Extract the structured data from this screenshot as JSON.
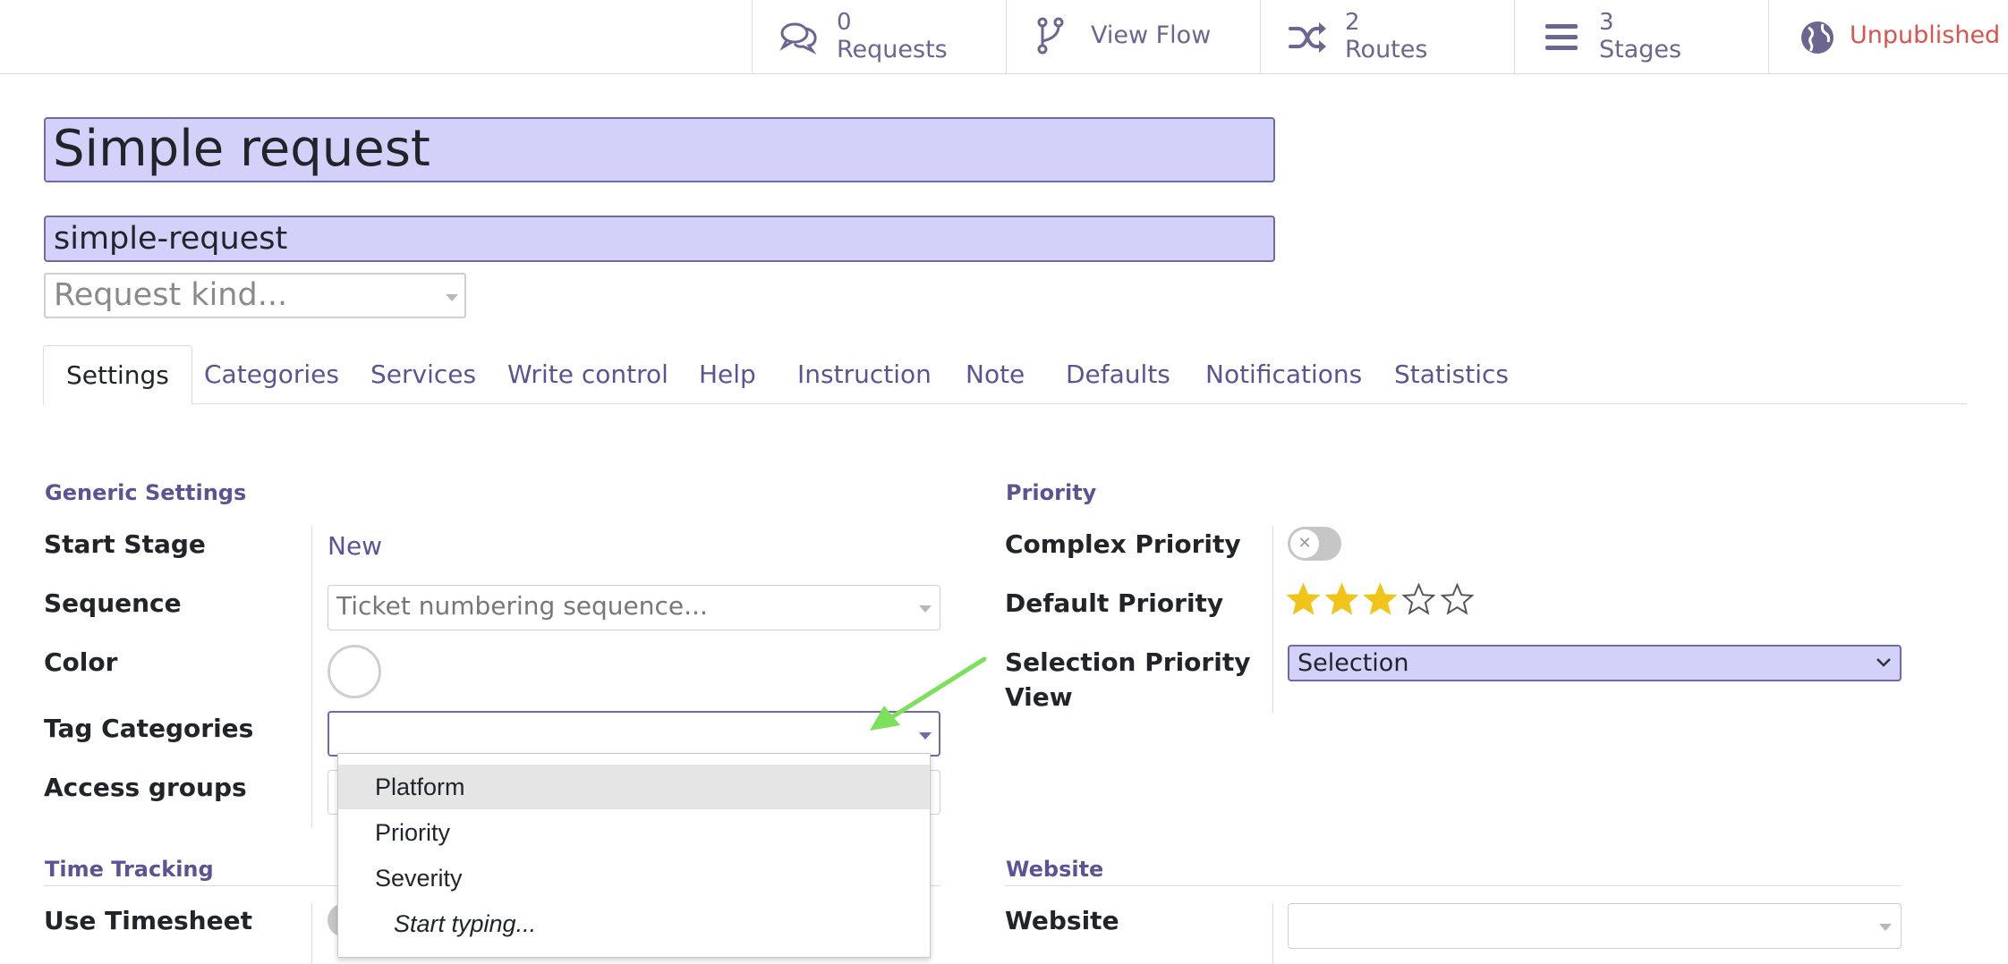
{
  "stat_buttons": {
    "requests": {
      "count": "0",
      "label": "Requests",
      "icon": "chat-bubbles-icon"
    },
    "view_flow": {
      "label": "View Flow",
      "icon": "branch-icon"
    },
    "routes": {
      "count": "2",
      "label": "Routes",
      "icon": "shuffle-icon"
    },
    "stages": {
      "count": "3",
      "label": "Stages",
      "icon": "bars-icon"
    },
    "publish": {
      "label": "Unpublished",
      "icon": "globe-icon"
    }
  },
  "header": {
    "name": "Simple request",
    "code": "simple-request",
    "kind_placeholder": "Request kind..."
  },
  "tabs": [
    "Settings",
    "Categories",
    "Services",
    "Write control",
    "Help",
    "Instruction",
    "Note",
    "Defaults",
    "Notifications",
    "Statistics"
  ],
  "generic_settings": {
    "title": "Generic Settings",
    "start_stage_label": "Start Stage",
    "start_stage_value": "New",
    "sequence_label": "Sequence",
    "sequence_placeholder": "Ticket numbering sequence...",
    "color_label": "Color",
    "tag_categories_label": "Tag Categories",
    "access_groups_label": "Access groups"
  },
  "priority": {
    "title": "Priority",
    "complex_priority_label": "Complex Priority",
    "default_priority_label": "Default Priority",
    "default_priority_stars": 3,
    "default_priority_max": 5,
    "selection_view_label_1": "Selection Priority",
    "selection_view_label_2": "View",
    "selection_view_value": "Selection"
  },
  "time_tracking": {
    "title": "Time Tracking",
    "use_timesheet_label": "Use Timesheet"
  },
  "website": {
    "title": "Website",
    "website_label": "Website"
  },
  "dropdown": {
    "items": [
      "Platform",
      "Priority",
      "Severity"
    ],
    "hint": "Start typing..."
  },
  "colors": {
    "accent": "#5b5494",
    "field_highlight": "#d3d0fa",
    "unpublished": "#d9534f",
    "star": "#f0c419",
    "arrow": "#7be05a"
  }
}
